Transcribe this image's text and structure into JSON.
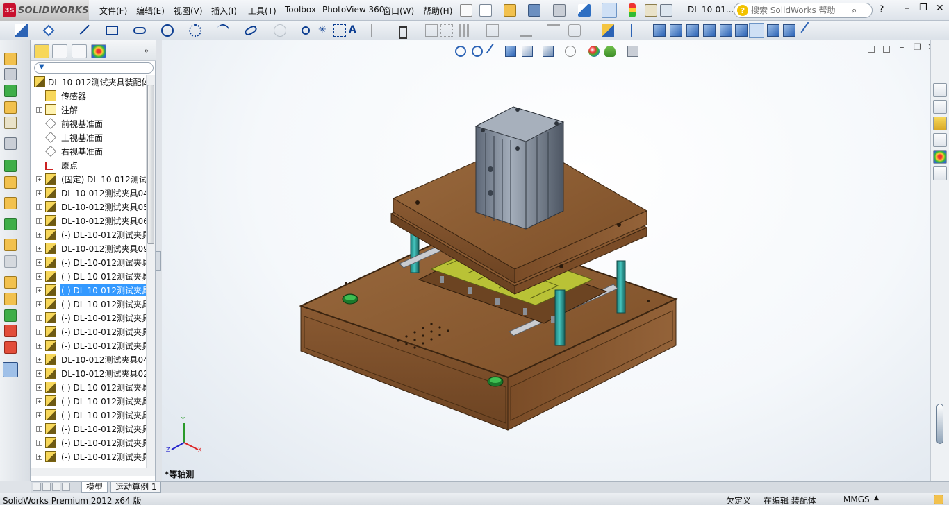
{
  "app": {
    "logo_text": "SOLIDWORKS",
    "document_title": "DL-10-01...",
    "search_placeholder": "搜索 SolidWorks 帮助"
  },
  "menu": [
    "文件(F)",
    "编辑(E)",
    "视图(V)",
    "插入(I)",
    "工具(T)",
    "Toolbox",
    "PhotoView 360",
    "窗口(W)",
    "帮助(H)"
  ],
  "tree": {
    "root": "DL-10-012测试夹具装配体",
    "items": [
      {
        "label": "传感器",
        "expand": false,
        "icon": "sensor-icon"
      },
      {
        "label": "注解",
        "expand": true,
        "icon": "annotation-icon"
      },
      {
        "label": "前视基准面",
        "expand": false,
        "icon": "plane-icon"
      },
      {
        "label": "上视基准面",
        "expand": false,
        "icon": "plane-icon"
      },
      {
        "label": "右视基准面",
        "expand": false,
        "icon": "plane-icon"
      },
      {
        "label": "原点",
        "expand": false,
        "icon": "origin-icon"
      },
      {
        "label": "(固定) DL-10-012测试",
        "expand": true,
        "icon": "part-icon"
      },
      {
        "label": "DL-10-012测试夹具04",
        "expand": true,
        "icon": "part-icon"
      },
      {
        "label": "DL-10-012测试夹具05",
        "expand": true,
        "icon": "part-icon"
      },
      {
        "label": "DL-10-012测试夹具06",
        "expand": true,
        "icon": "part-icon"
      },
      {
        "label": "(-) DL-10-012测试夹具",
        "expand": true,
        "icon": "part-icon"
      },
      {
        "label": "DL-10-012测试夹具09",
        "expand": true,
        "icon": "part-icon"
      },
      {
        "label": "(-) DL-10-012测试夹具",
        "expand": true,
        "icon": "part-icon"
      },
      {
        "label": "(-) DL-10-012测试夹具",
        "expand": true,
        "icon": "part-icon"
      },
      {
        "label": "(-) DL-10-012测试夹具",
        "expand": true,
        "icon": "part-icon",
        "selected": true
      },
      {
        "label": "(-) DL-10-012测试夹具",
        "expand": true,
        "icon": "part-icon"
      },
      {
        "label": "(-) DL-10-012测试夹具",
        "expand": true,
        "icon": "part-icon"
      },
      {
        "label": "(-) DL-10-012测试夹具",
        "expand": true,
        "icon": "part-icon"
      },
      {
        "label": "(-) DL-10-012测试夹具",
        "expand": true,
        "icon": "part-icon"
      },
      {
        "label": "DL-10-012测试夹具04",
        "expand": true,
        "icon": "part-icon"
      },
      {
        "label": "DL-10-012测试夹具02",
        "expand": true,
        "icon": "part-icon"
      },
      {
        "label": "(-) DL-10-012测试夹具",
        "expand": true,
        "icon": "part-icon"
      },
      {
        "label": "(-) DL-10-012测试夹具",
        "expand": true,
        "icon": "part-icon"
      },
      {
        "label": "(-) DL-10-012测试夹具",
        "expand": true,
        "icon": "part-icon"
      },
      {
        "label": "(-) DL-10-012测试夹具",
        "expand": true,
        "icon": "part-icon"
      },
      {
        "label": "(-) DL-10-012测试夹具",
        "expand": true,
        "icon": "part-icon"
      },
      {
        "label": "(-) DL-10-012测试夹具",
        "expand": true,
        "icon": "part-icon"
      }
    ]
  },
  "viewport": {
    "view_label": "*等轴测",
    "triad": {
      "x": "X",
      "y": "Y",
      "z": "Z"
    }
  },
  "bottom_tabs": [
    "模型",
    "运动算例 1"
  ],
  "status": {
    "product": "SolidWorks Premium 2012 x64 版",
    "state1": "欠定义",
    "state2": "在编辑 装配体",
    "units": "MMGS"
  },
  "colors": {
    "selection": "#3399ff",
    "wood": "#8a5a32",
    "cylinder": "#7d8a99",
    "pillar": "#2aa6a0",
    "pcb": "#b9c236"
  }
}
